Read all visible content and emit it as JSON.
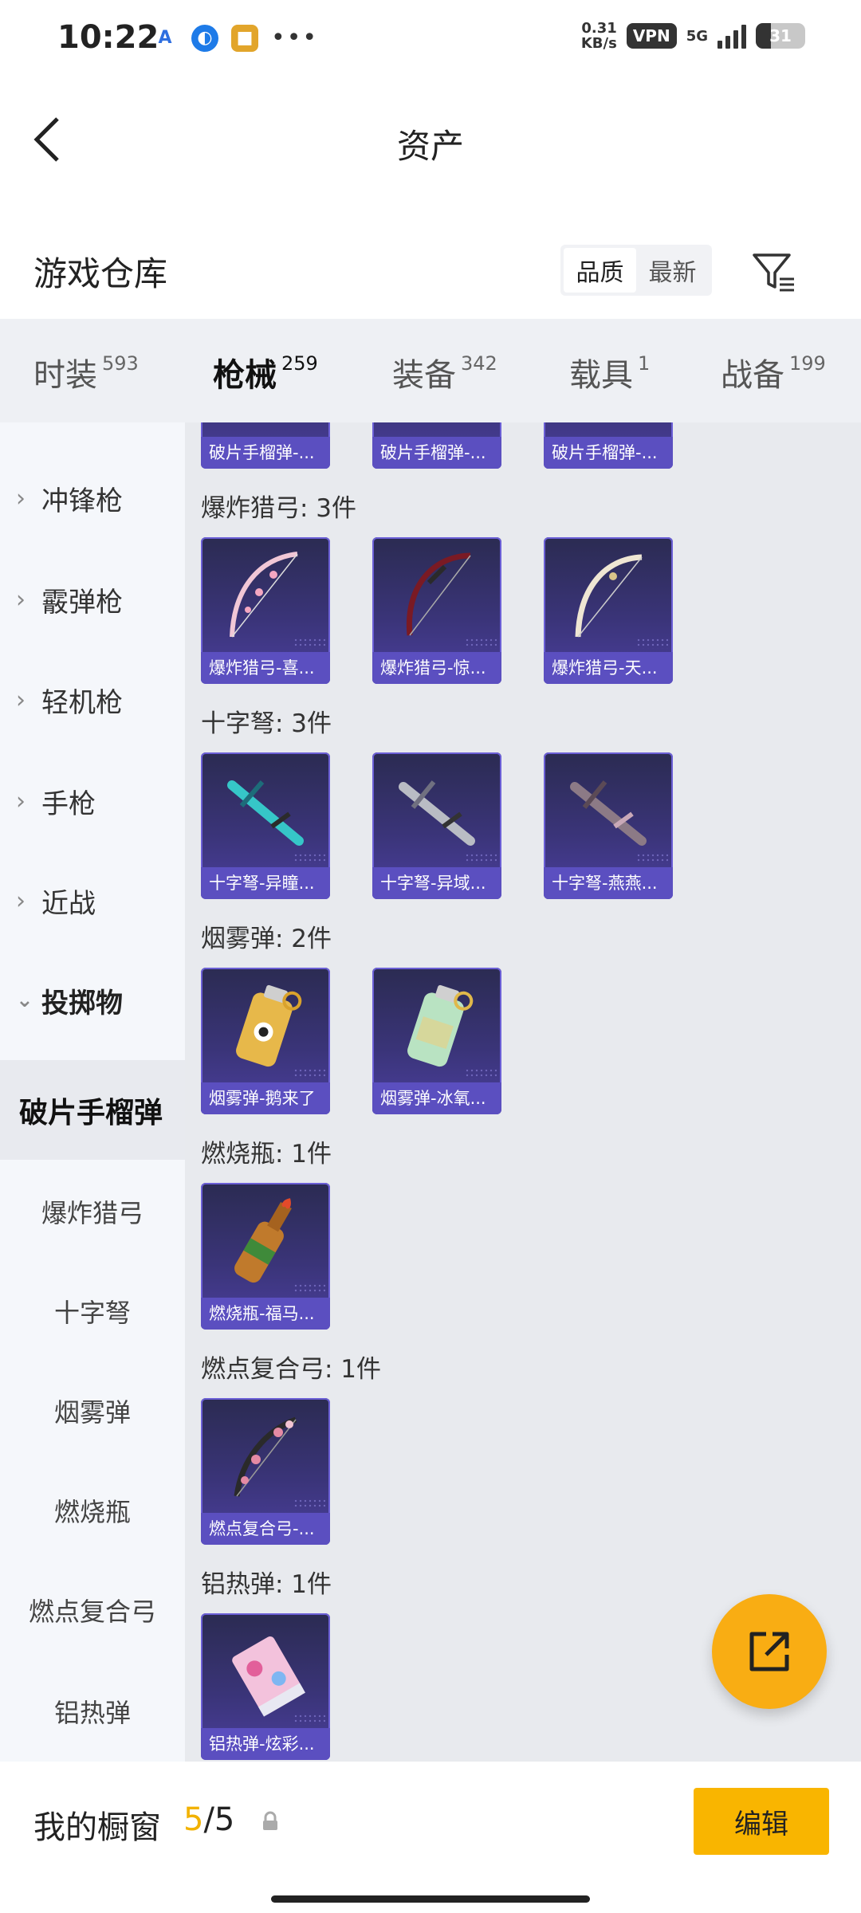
{
  "status_bar": {
    "time": "10:22",
    "speed_value": "0.31",
    "speed_unit": "KB/s",
    "vpn": "VPN",
    "network": "5G",
    "battery": "31",
    "battery_level": 0.31
  },
  "header": {
    "title": "资产"
  },
  "warehouse": {
    "title": "游戏仓库",
    "sort_options": [
      "品质",
      "最新"
    ],
    "sort_selected": "品质"
  },
  "tabs": [
    {
      "label": "时装",
      "count": "593"
    },
    {
      "label": "枪械",
      "count": "259",
      "active": true
    },
    {
      "label": "装备",
      "count": "342"
    },
    {
      "label": "载具",
      "count": "1"
    },
    {
      "label": "战备",
      "count": "199"
    }
  ],
  "sidebar": {
    "items": [
      {
        "label": "冲锋枪"
      },
      {
        "label": "霰弹枪"
      },
      {
        "label": "轻机枪"
      },
      {
        "label": "手枪"
      },
      {
        "label": "近战"
      },
      {
        "label": "投掷物"
      }
    ],
    "sub_items": [
      {
        "label": "破片手榴弹"
      },
      {
        "label": "爆炸猎弓"
      },
      {
        "label": "十字弩"
      },
      {
        "label": "烟雾弹"
      },
      {
        "label": "燃烧瓶"
      },
      {
        "label": "燃点复合弓"
      },
      {
        "label": "铝热弹"
      }
    ]
  },
  "content": {
    "top_partial_cards": [
      "破片手榴弹-...",
      "破片手榴弹-...",
      "破片手榴弹-..."
    ],
    "groups": [
      {
        "title": "爆炸猎弓: 3件",
        "items": [
          "爆炸猎弓-喜...",
          "爆炸猎弓-惊...",
          "爆炸猎弓-天..."
        ]
      },
      {
        "title": "十字弩: 3件",
        "items": [
          "十字弩-异瞳...",
          "十字弩-异域...",
          "十字弩-燕燕..."
        ]
      },
      {
        "title": "烟雾弹: 2件",
        "items": [
          "烟雾弹-鹅来了",
          "烟雾弹-冰氧..."
        ]
      },
      {
        "title": "燃烧瓶: 1件",
        "items": [
          "燃烧瓶-福马..."
        ]
      },
      {
        "title": "燃点复合弓: 1件",
        "items": [
          "燃点复合弓-..."
        ]
      },
      {
        "title": "铝热弹: 1件",
        "items": [
          "铝热弹-炫彩..."
        ]
      }
    ]
  },
  "bottom": {
    "label": "我的橱窗",
    "count_current": "5",
    "count_total": "/5",
    "edit": "编辑"
  },
  "colors": {
    "accent": "#f9b500",
    "card_bg": "#3a3478",
    "caption_bg": "#5b4fc0"
  },
  "icons": [
    "back-icon",
    "filter-icon",
    "share-icon",
    "lock-icon",
    "chevron-right-icon",
    "chevron-down-icon"
  ]
}
